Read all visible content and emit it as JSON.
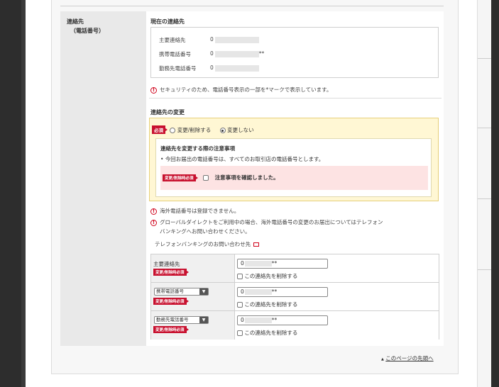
{
  "section": {
    "label_line1": "連絡先",
    "label_line2": "（電話番号）"
  },
  "current": {
    "title": "現在の連絡先",
    "rows": [
      {
        "label": "主要連絡先",
        "prefix": "0",
        "suffix": ""
      },
      {
        "label": "携帯電話番号",
        "prefix": "0",
        "suffix": "**"
      },
      {
        "label": "勤務先電話番号",
        "prefix": "0",
        "suffix": ""
      }
    ],
    "security_note": "セキュリティのため、電話番号表示の一部を*マークで表示しています。"
  },
  "change": {
    "title": "連絡先の変更",
    "required_badge": "必須",
    "options": [
      {
        "label": "変更/削除する",
        "selected": false
      },
      {
        "label": "変更しない",
        "selected": true
      }
    ],
    "notice_title": "連絡先を変更する際の注意事項",
    "notice_bullet": "今回お届出の電話番号は、すべてのお取引店の電話番号とします。",
    "notice_badge": "変更/削除時必須",
    "confirm_label": "注意事項を確認しました。"
  },
  "warnings": {
    "overseas": "海外電話番号は登録できません。",
    "global_line1": "グローバルダイレクトをご利用中の場合、海外電話番号の変更のお届出についてはテレフォン",
    "global_line2": "バンキングへお問い合わせください。"
  },
  "contact_link": "テレフォンバンキングのお問い合わせ先",
  "edit_rows": [
    {
      "label": "主要連絡先",
      "type": "text",
      "badge": "変更/削除時必須",
      "value_prefix": "0",
      "value_suffix": "**",
      "delete_label": "この連絡先を削除する"
    },
    {
      "label": "携帯電話番号",
      "type": "select",
      "badge": "変更/削除時必須",
      "value_prefix": "0",
      "value_suffix": "**",
      "delete_label": "この連絡先を削除する"
    },
    {
      "label": "勤務先電話番号",
      "type": "select",
      "badge": "変更/削除時必須",
      "value_prefix": "0",
      "value_suffix": "**",
      "delete_label": "この連絡先を削除する"
    }
  ],
  "page_top": {
    "arrow": "▲",
    "label": "このページの先頭へ"
  }
}
